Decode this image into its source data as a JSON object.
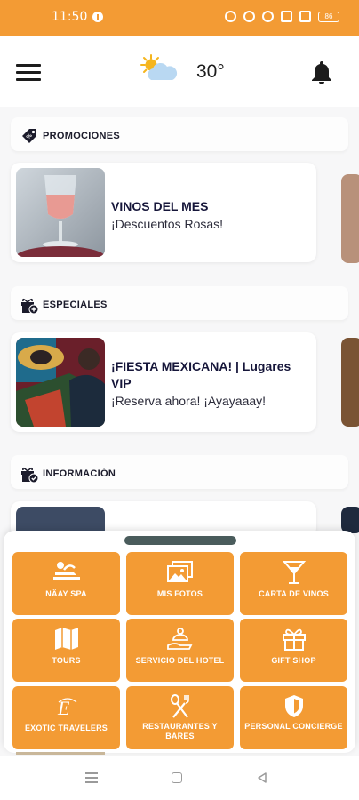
{
  "status_bar": {
    "time": "11:50",
    "battery": "86"
  },
  "header": {
    "menu_icon": "hamburger-icon",
    "weather_icon": "partly-sunny-icon",
    "temperature": "30°",
    "notification_icon": "bell-icon"
  },
  "sections": {
    "promociones": {
      "title": "PROMOCIONES",
      "icon": "price-tag-icon",
      "card": {
        "title": "VINOS DEL MES",
        "subtitle": "¡Descuentos Rosas!"
      }
    },
    "especiales": {
      "title": "ESPECIALES",
      "icon": "gift-add-icon",
      "card": {
        "title": "¡FIESTA MEXICANA! | Lugares VIP",
        "subtitle": "¡Reserva ahora! ¡Ayayaaay!"
      }
    },
    "informacion": {
      "title": "INFORMACIÓN",
      "icon": "gift-check-icon"
    }
  },
  "quick_menu": {
    "tiles": [
      {
        "label": "NÄAY SPA",
        "icon": "massage-icon"
      },
      {
        "label": "MIS FOTOS",
        "icon": "photos-icon"
      },
      {
        "label": "CARTA DE VINOS",
        "icon": "cocktail-glass-icon"
      },
      {
        "label": "TOURS",
        "icon": "map-icon"
      },
      {
        "label": "SERVICIO DEL HOTEL",
        "icon": "room-service-icon"
      },
      {
        "label": "GIFT SHOP",
        "icon": "gift-icon"
      },
      {
        "label": "EXOTIC TRAVELERS",
        "icon": "et-logo-icon"
      },
      {
        "label": "RESTAURANTES Y BARES",
        "icon": "fork-spoon-icon"
      },
      {
        "label": "PERSONAL CONCIERGE",
        "icon": "concierge-shield-icon"
      }
    ]
  },
  "colors": {
    "accent": "#f39b34",
    "tile_text": "#ffffff",
    "title_text": "#16163a"
  }
}
